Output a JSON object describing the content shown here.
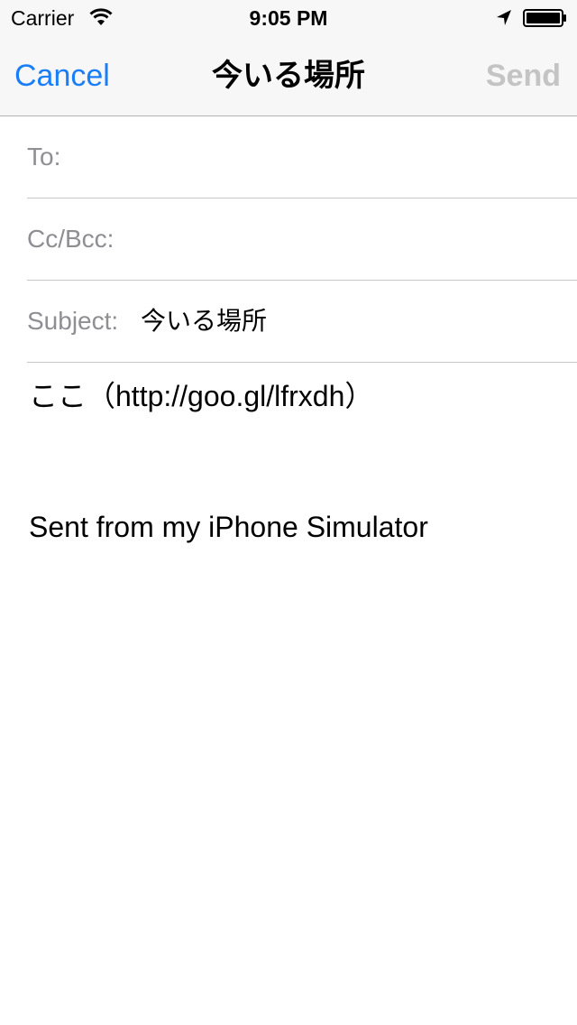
{
  "status_bar": {
    "carrier": "Carrier",
    "time": "9:05 PM",
    "icons": [
      "wifi-icon",
      "location-arrow-icon",
      "battery-icon"
    ]
  },
  "nav": {
    "cancel_label": "Cancel",
    "title": "今いる場所",
    "send_label": "Send"
  },
  "fields": {
    "to_label": "To:",
    "to_value": "",
    "cc_label": "Cc/Bcc:",
    "cc_value": "",
    "subject_label": "Subject:",
    "subject_value": "今いる場所"
  },
  "body": {
    "line1": "ここ（http://goo.gl/lfrxdh）",
    "signature": "Sent from my iPhone Simulator"
  },
  "colors": {
    "accent": "#1a7ef7",
    "disabled": "#c4c4c4",
    "label_gray": "#8e8e93",
    "bar_background": "#f7f7f7"
  }
}
